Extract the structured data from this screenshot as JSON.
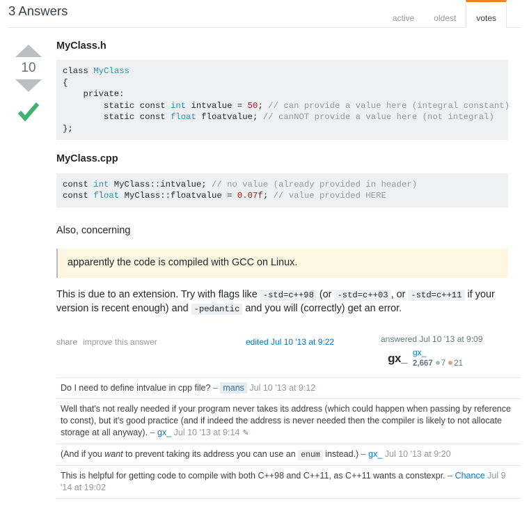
{
  "header": {
    "answers_count": "3 Answers",
    "tabs": [
      {
        "label": "active",
        "active": false
      },
      {
        "label": "oldest",
        "active": false
      },
      {
        "label": "votes",
        "active": true
      }
    ],
    "active_tab_color": "#f48024"
  },
  "answer": {
    "vote_count": "10",
    "accepted": true,
    "accepted_color": "#3cb371",
    "arrow_color": "#babfc4",
    "headings": {
      "header_file": "MyClass.h",
      "source_file": "MyClass.cpp"
    },
    "code_header": {
      "line1_kw": "class",
      "line1_type": "MyClass",
      "line2": "{",
      "line3": "    private:",
      "line4_a": "        static const ",
      "line4_type": "int",
      "line4_b": " intvalue = ",
      "line4_num": "50",
      "line4_c": "; ",
      "line4_com": "// can provide a value here (integral constant)",
      "line5_a": "        static const ",
      "line5_type": "float",
      "line5_b": " floatvalue; ",
      "line5_com": "// canNOT provide a value here (not integral)",
      "line6": "};"
    },
    "code_source": {
      "l1_a": "const ",
      "l1_type": "int",
      "l1_b": " MyClass::intvalue; ",
      "l1_com": "// no value (already provided in header)",
      "l2_a": "const ",
      "l2_type": "float",
      "l2_b": " MyClass::floatvalue = ",
      "l2_num": "0.07f",
      "l2_c": "; ",
      "l2_com": "// value provided HERE"
    },
    "also_concerning": "Also, concerning",
    "quote": "apparently the code is compiled with GCC on Linux.",
    "paragraph": {
      "t1": "This is due to an extension. Try with flags like ",
      "c1": "-std=c++98",
      "t2": " (or ",
      "c2": "-std=c++03",
      "t3": ", or ",
      "c3": "-std=c++11",
      "t4": " if your version is recent enough) and ",
      "c4": "-pedantic",
      "t5": " and you will (correctly) get an error."
    },
    "actions": {
      "share": "share",
      "improve": "improve this answer"
    },
    "edited": "edited Jul 10 '13 at 9:22",
    "answered": "answered Jul 10 '13 at 9:09",
    "user": {
      "gravatar_text": "gx_",
      "name": "gx_",
      "reputation": "2,667",
      "silver_badges": "7",
      "bronze_badges": "21"
    }
  },
  "comments": [
    {
      "text": "Do I need to define intvalue in cpp file? ",
      "dash": "– ",
      "user": "mans",
      "is_op": true,
      "date": "Jul 10 '13 at 9:12",
      "has_edit_icon": false
    },
    {
      "text_a": "Well that's not really needed if your program never takes its address (which could happen when passing by reference to const), but it's good practice (and if indeed the address is never needed then the compiler is likely to not allocate storage at all anyway). ",
      "dash": "– ",
      "user": "gx_",
      "is_op": false,
      "date": "Jul 10 '13 at 9:14",
      "has_edit_icon": true
    },
    {
      "text_a": "(And if you ",
      "em": "want",
      "text_b": " to prevent taking its address you can use an ",
      "code": "enum",
      "text_c": " instead.) ",
      "dash": "– ",
      "user": "gx_",
      "is_op": false,
      "date": "Jul 10 '13 at 9:20",
      "has_edit_icon": false
    },
    {
      "text_a": "This is helpful for getting code to compile with both C++98 and C++11, as C++11 wants a constexpr. ",
      "dash": "– ",
      "user": "Chance",
      "is_op": false,
      "date": "Jul 9 '14 at 19:02",
      "has_edit_icon": false
    }
  ]
}
